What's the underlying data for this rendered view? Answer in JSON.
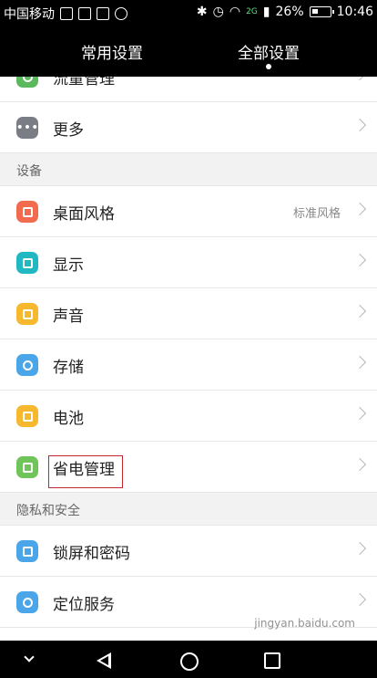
{
  "status": {
    "carrier": "中国移动",
    "network": "2G",
    "battery": "26%",
    "time": "10:46"
  },
  "tabs": {
    "common": "常用设置",
    "all": "全部设置"
  },
  "rows": {
    "data_usage": "流量管理",
    "more": "更多",
    "home_style": {
      "label": "桌面风格",
      "value": "标准风格"
    },
    "display": "显示",
    "sound": "声音",
    "storage": "存储",
    "battery": "电池",
    "power_saving": "省电管理",
    "screen_lock": "锁屏和密码",
    "location": "定位服务"
  },
  "sections": {
    "device": "设备",
    "privacy": "隐私和安全"
  },
  "watermark": "jingyan.baidu.com",
  "colors": {
    "data_usage": "#5cb85c",
    "more": "#7a7d84",
    "home_style": "#f26b4f",
    "display": "#21b8c2",
    "sound": "#f5b82e",
    "storage": "#4aa6e8",
    "battery": "#f5b82e",
    "power_saving": "#6fc45a",
    "screen_lock": "#4aa6e8",
    "location": "#4aa6e8"
  }
}
